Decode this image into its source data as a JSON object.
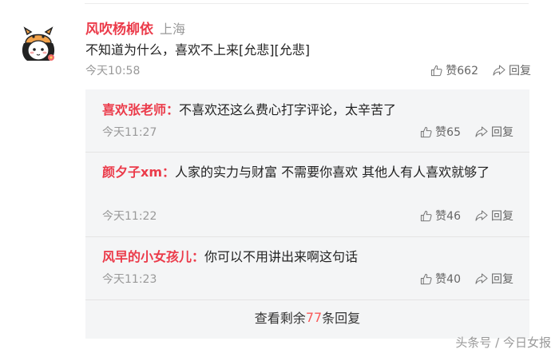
{
  "comment": {
    "username": "风吹杨柳依",
    "location": "上海",
    "text": "不知道为什么，喜欢不上来[允悲][允悲]",
    "time": "今天10:58",
    "like_label": "赞662",
    "reply_label": "回复",
    "avatar_icon": "cartoon-girl-avatar-icon"
  },
  "replies": [
    {
      "username": "喜欢张老师：",
      "text": "不喜欢还这么费心打字评论，太辛苦了",
      "time": "今天11:27",
      "like_label": "赞65",
      "reply_label": "回复"
    },
    {
      "username": "颜夕子xm：",
      "text": "人家的实力与财富 不需要你喜欢 其他人有人喜欢就够了",
      "time": "今天11:22",
      "like_label": "赞46",
      "reply_label": "回复"
    },
    {
      "username": "风早的小女孩儿：",
      "text": "你可以不用讲出来啊这句话",
      "time": "今天11:23",
      "like_label": "赞40",
      "reply_label": "回复"
    }
  ],
  "more_replies": {
    "prefix": "查看剩余",
    "count": "77",
    "suffix": "条回复"
  },
  "watermark": "头条号 / 今日女报",
  "colors": {
    "username": "#eb3b4a",
    "count_highlight": "#f85959",
    "meta": "#999999",
    "reply_bg": "#f4f5f6"
  }
}
